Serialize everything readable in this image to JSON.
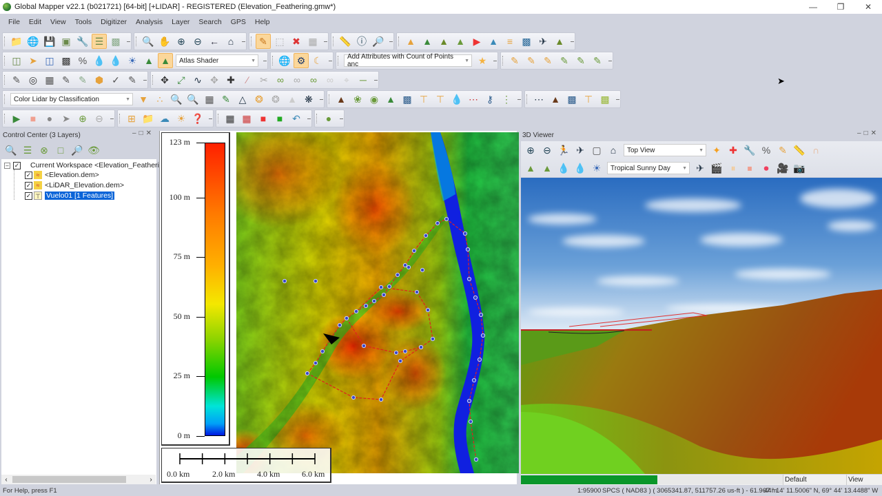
{
  "window": {
    "title": "Global Mapper v22.1 (b021721) [64-bit] [+LIDAR] - REGISTERED (Elevation_Feathering.gmw*)",
    "controls": [
      "minimize",
      "restore",
      "close"
    ]
  },
  "menu": [
    "File",
    "Edit",
    "View",
    "Tools",
    "Digitizer",
    "Analysis",
    "Layer",
    "Search",
    "GPS",
    "Help"
  ],
  "toolbars": {
    "shader_combo": "Atlas Shader",
    "attributes_combo": "Add Attributes with Count of Points anc",
    "lidar_combo": "Color Lidar by Classification"
  },
  "control_center": {
    "title": "Control Center (3 Layers)",
    "workspace": "Current Workspace <Elevation_Featherin",
    "layers": [
      {
        "name": "<Elevation.dem>",
        "checked": true,
        "type": "elevation"
      },
      {
        "name": "<LiDAR_Elevation.dem>",
        "checked": true,
        "type": "elevation"
      },
      {
        "name": "Vuelo01 [1 Features]",
        "checked": true,
        "type": "vector",
        "selected": true
      }
    ]
  },
  "elevation_legend": {
    "labels": [
      "123 m",
      "100 m",
      "75 m",
      "50 m",
      "25 m",
      "0 m"
    ],
    "values": [
      123,
      100,
      75,
      50,
      25,
      0
    ],
    "min": 0,
    "max": 123,
    "colors": [
      "#0018e0",
      "#00e4f0",
      "#00c800",
      "#8ed400",
      "#f4e800",
      "#ffa000",
      "#ff6000",
      "#ff2000"
    ]
  },
  "scale_bar": {
    "labels": [
      "0.0 km",
      "2.0 km",
      "4.0 km",
      "6.0 km"
    ]
  },
  "viewer3d": {
    "title": "3D Viewer",
    "view_combo": "Top View",
    "sky_combo": "Tropical Sunny Day",
    "progress": 0.52,
    "status_default": "Default",
    "status_view": "View"
  },
  "status": {
    "help": "For Help, press F1",
    "scale": "1:95900",
    "coords": "SPCS ( NAD83 ) ( 3065341.87, 511757.26 us-ft ) - 61.967 m",
    "latlon": "44° 14' 11.5006\" N, 69° 44' 13.4488\" W"
  }
}
